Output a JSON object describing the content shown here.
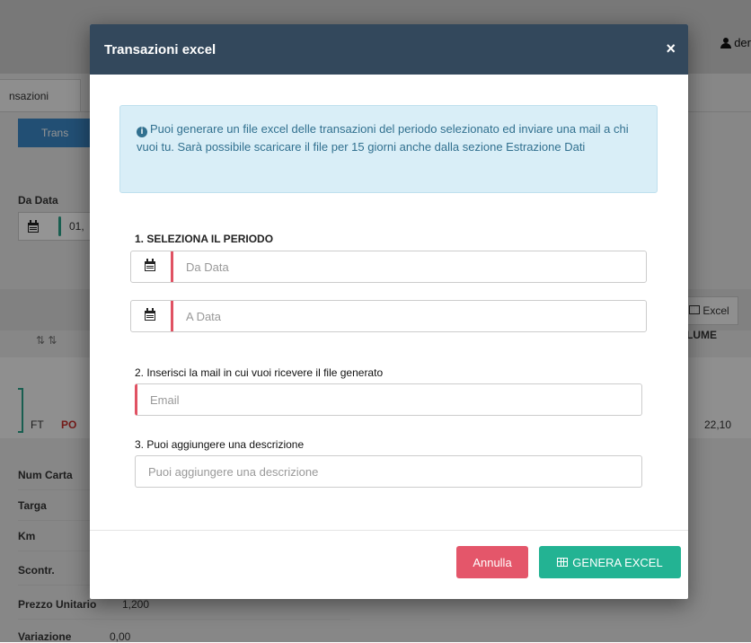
{
  "background": {
    "user_label": "der",
    "tab_label": "nsazioni",
    "transazioni_button": "Trans",
    "da_data_label": "Da Data",
    "da_data_value": "01,",
    "excel_button": "Excel",
    "volume_header": "LUME",
    "row_ft": "FT",
    "row_po": "PO",
    "row_volume": "22,10",
    "details": {
      "num_carta": "Num Carta",
      "targa": "Targa",
      "km": "Km",
      "scontr": "Scontr.",
      "prezzo_unitario": "Prezzo Unitario",
      "prezzo_value": "1,200",
      "variazione": "Variazione",
      "variazione_value": "0,00"
    }
  },
  "modal": {
    "title": "Transazioni excel",
    "close_glyph": "×",
    "info_text": "Puoi generare un file excel delle transazioni del periodo selezionato ed inviare una mail a chi vuoi tu. Sarà possibile scaricare il file per 15 giorni anche dalla sezione Estrazione Dati",
    "section1_label": "1. SELEZIONA IL PERIODO",
    "from_date_placeholder": "Da Data",
    "to_date_placeholder": "A Data",
    "section2_label": "2. Inserisci la mail in cui vuoi ricevere il file generato",
    "email_placeholder": "Email",
    "section3_label": "3. Puoi aggiungere una descrizione",
    "description_placeholder": "Puoi aggiungere una descrizione",
    "cancel_label": "Annulla",
    "generate_label": "GENERA EXCEL"
  },
  "colors": {
    "header_bg": "#33485c",
    "info_bg": "#d9eef7",
    "required_border": "#e05263",
    "cancel_bg": "#e4566a",
    "generate_bg": "#23b393"
  }
}
